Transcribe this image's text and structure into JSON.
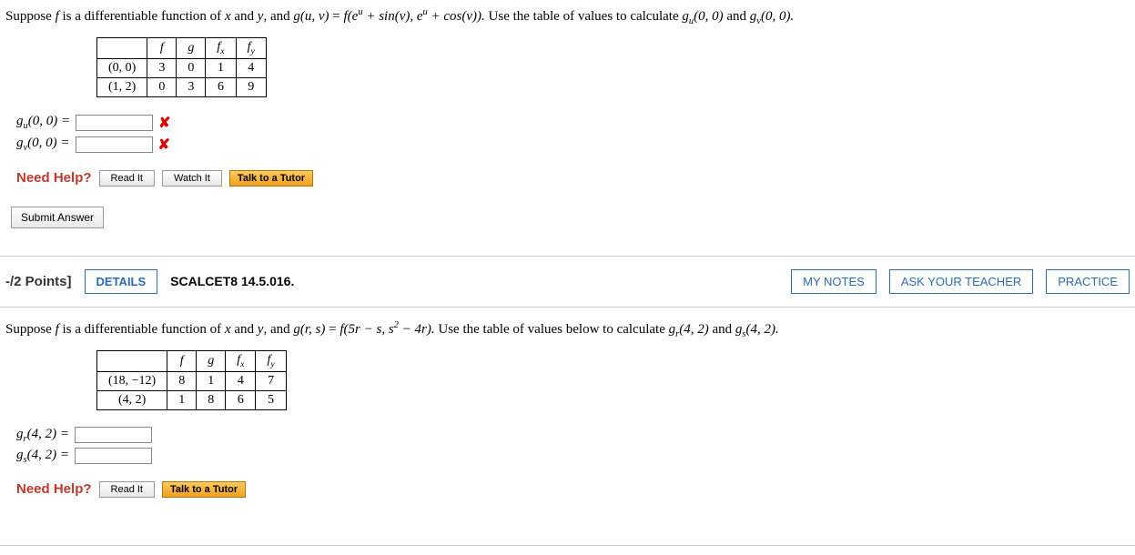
{
  "q1": {
    "prompt_pre": "Suppose ",
    "prompt_mid1": " is a differentiable function of ",
    "prompt_mid2": " and ",
    "prompt_mid3": ", and ",
    "prompt_defn_lhs": "g(u, v)",
    "prompt_eq": " = ",
    "prompt_defn_rhs": "f(e",
    "prompt_rhs2": " + sin(v), e",
    "prompt_rhs3": " + cos(v)).",
    "prompt_tail": "  Use the table of values to calculate ",
    "prompt_g1": "g",
    "prompt_g1sub": "u",
    "prompt_g1args": "(0, 0)",
    "prompt_and": "  and  ",
    "prompt_g2": "g",
    "prompt_g2sub": "v",
    "prompt_g2args": "(0, 0).",
    "table": {
      "head": [
        "",
        "f",
        "g",
        "f",
        "f"
      ],
      "head_sub": [
        "",
        "",
        "",
        "x",
        "y"
      ],
      "rows": [
        [
          "(0, 0)",
          "3",
          "0",
          "1",
          "4"
        ],
        [
          "(1, 2)",
          "0",
          "3",
          "6",
          "9"
        ]
      ]
    },
    "ans": {
      "gu_label": "g",
      "gu_sub": "u",
      "gu_args": "(0, 0)  =",
      "gv_label": "g",
      "gv_sub": "v",
      "gv_args": "(0, 0)  =",
      "gu_value": "",
      "gv_value": ""
    },
    "help": {
      "label": "Need Help?",
      "read": "Read It",
      "watch": "Watch It",
      "tutor": "Talk to a Tutor"
    },
    "submit": "Submit Answer"
  },
  "header2": {
    "points": "-/2 Points]",
    "details": "DETAILS",
    "code": "SCALCET8 14.5.016.",
    "notes": "MY NOTES",
    "ask": "ASK YOUR TEACHER",
    "practice": "PRACTICE"
  },
  "q2": {
    "prompt_pre": "Suppose ",
    "prompt_mid1": " is a differentiable function of ",
    "prompt_mid2": " and ",
    "prompt_mid3": ", and ",
    "prompt_defn_lhs": "g(r, s)",
    "prompt_eq": " = ",
    "prompt_rhs": "f(5r − s, s",
    "prompt_rhs2": " − 4r).",
    "prompt_tail": "  Use the table of values below to calculate ",
    "prompt_g1": "g",
    "prompt_g1sub": "r",
    "prompt_g1args": "(4, 2)",
    "prompt_and": "  and  ",
    "prompt_g2": "g",
    "prompt_g2sub": "s",
    "prompt_g2args": "(4, 2).",
    "table": {
      "head": [
        "",
        "f",
        "g",
        "f",
        "f"
      ],
      "head_sub": [
        "",
        "",
        "",
        "x",
        "y"
      ],
      "rows": [
        [
          "(18, −12)",
          "8",
          "1",
          "4",
          "7"
        ],
        [
          "(4, 2)",
          "1",
          "8",
          "6",
          "5"
        ]
      ]
    },
    "ans": {
      "gr_label": "g",
      "gr_sub": "r",
      "gr_args": "(4, 2)  =",
      "gs_label": "g",
      "gs_sub": "s",
      "gs_args": "(4, 2)  =",
      "gr_value": "",
      "gs_value": ""
    },
    "help": {
      "label": "Need Help?",
      "read": "Read It",
      "tutor": "Talk to a Tutor"
    }
  }
}
